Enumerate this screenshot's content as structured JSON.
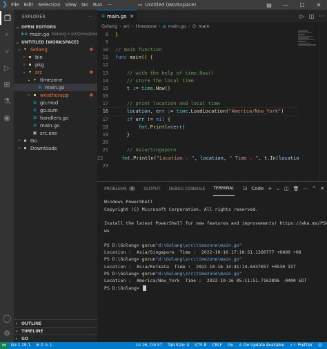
{
  "titlebar": {
    "menu": [
      "File",
      "Edit",
      "Selection",
      "View",
      "Go",
      "Run",
      "···"
    ],
    "title": "Untitled (Workspace)"
  },
  "sidebar": {
    "header": "EXPLORER",
    "open_editors": "OPEN EDITORS",
    "open_file": {
      "name": "main.go",
      "desc": "Golang • src\\timezone"
    },
    "workspace": "UNTITLED (WORKSPACE)",
    "tree": [
      {
        "label": "Golang",
        "kind": "folder",
        "open": true,
        "indent": 0,
        "color": "#e37933",
        "dot": true
      },
      {
        "label": "bin",
        "kind": "folder",
        "open": false,
        "indent": 1
      },
      {
        "label": "pkg",
        "kind": "folder",
        "open": false,
        "indent": 1
      },
      {
        "label": "src",
        "kind": "folder",
        "open": true,
        "indent": 1,
        "color": "#e37933",
        "dot": true
      },
      {
        "label": "timezone",
        "kind": "folder",
        "open": true,
        "indent": 2
      },
      {
        "label": "main.go",
        "kind": "go",
        "indent": 3,
        "selected": true
      },
      {
        "label": "weatherapp",
        "kind": "folder",
        "open": false,
        "indent": 2,
        "color": "#e37933",
        "dot": true
      },
      {
        "label": "go.mod",
        "kind": "go",
        "indent": 2
      },
      {
        "label": "go.sum",
        "kind": "go",
        "indent": 2
      },
      {
        "label": "handlers.go",
        "kind": "go",
        "indent": 2
      },
      {
        "label": "main.go",
        "kind": "go",
        "indent": 2
      },
      {
        "label": "src.exe",
        "kind": "exe",
        "indent": 2
      },
      {
        "label": "Go",
        "kind": "folder",
        "open": false,
        "indent": 0
      },
      {
        "label": "Downloads",
        "kind": "folder",
        "open": false,
        "indent": 0
      }
    ],
    "outline": "OUTLINE",
    "timeline": "TIMELINE",
    "go_section": "GO"
  },
  "editor": {
    "tab": "main.go",
    "breadcrumb": [
      "Golang",
      "src",
      "timezone",
      "main.go",
      "main"
    ],
    "lines": [
      {
        "n": 8,
        "html": "<span class=\"pu\">}</span>"
      },
      {
        "n": 9,
        "html": ""
      },
      {
        "n": 10,
        "html": "<span class=\"cm\">// main function</span>"
      },
      {
        "n": 11,
        "html": "<span class=\"kw\">func</span> <span class=\"fn\">main</span><span class=\"pu\">()</span> <span class=\"pu\">{</span>"
      },
      {
        "n": 12,
        "html": ""
      },
      {
        "n": 13,
        "html": "    <span class=\"cm\">// with the help of time.Now()</span>"
      },
      {
        "n": 14,
        "html": "    <span class=\"cm\">// store the local time</span>"
      },
      {
        "n": 15,
        "html": "    <span class=\"vr\">t</span> := <span class=\"ty\">time</span>.<span class=\"fn\">Now</span>()"
      },
      {
        "n": 16,
        "html": ""
      },
      {
        "n": 17,
        "html": "    <span class=\"cm\">// print location and local time</span>"
      },
      {
        "n": 16,
        "html": "    <span class=\"vr\">location</span>, <span class=\"vr\">err</span> := <span class=\"ty\">time</span>.<span class=\"fn\">LoadLocation</span>(<span class=\"st\">\"America/New_York\"</span>)",
        "current": true
      },
      {
        "n": 17,
        "html": "    <span class=\"kw\">if</span> <span class=\"vr\">err</span> != <span class=\"kw\">nil</span> {"
      },
      {
        "n": 18,
        "html": "        <span class=\"ty\">fmt</span>.<span class=\"fn\">Println</span>(<span class=\"vr\">err</span>)"
      },
      {
        "n": 19,
        "html": "    }"
      },
      {
        "n": 20,
        "html": ""
      },
      {
        "n": 21,
        "html": "    <span class=\"cm\">// Asia/Singapore</span>"
      },
      {
        "n": 22,
        "html": "    <span class=\"ty\">fmt</span>.<span class=\"fn\">Println</span>(<span class=\"st\">\"Location : \"</span>, <span class=\"vr\">location</span>, <span class=\"st\">\" Time : \"</span>, <span class=\"vr\">t</span>.<span class=\"fn\">In</span>(<span class=\"vr\">locatio</span>"
      },
      {
        "n": 23,
        "html": ""
      }
    ]
  },
  "panel": {
    "tabs": [
      {
        "label": "PROBLEMS",
        "badge": "1"
      },
      {
        "label": "OUTPUT"
      },
      {
        "label": "DEBUG CONSOLE"
      },
      {
        "label": "TERMINAL",
        "active": true
      }
    ],
    "shell_label": "Code",
    "terminal": [
      {
        "html": "Windows PowerShell"
      },
      {
        "html": "Copyright (C) Microsoft Corporation. All rights reserved."
      },
      {
        "html": ""
      },
      {
        "html": "Install the latest PowerShell for new features and improvements! https://aka.ms/PSWindo"
      },
      {
        "html": "ws"
      },
      {
        "html": ""
      },
      {
        "html": "PS D:\\Golang&gt; <span class=\"cmd\">go</span> <span class=\"arg\">run</span> <span class=\"path\">\"d:\\Golang\\src\\timezone\\main.go\"</span>"
      },
      {
        "html": "Location :  Asia/Singapore  Time :  2022-10-16 17:10:51.1360777 +0800 +08"
      },
      {
        "html": "PS D:\\Golang&gt; <span class=\"cmd\">go</span> <span class=\"arg\">run</span> <span class=\"path\">\"d:\\Golang\\src\\timezone\\main.go\"</span>"
      },
      {
        "html": "Location :  Asia/Kolkata  Time :  2022-10-16 14:41:14.6437657 +0530 IST"
      },
      {
        "html": "PS D:\\Golang&gt; <span class=\"cmd\">go</span> <span class=\"arg\">run</span> <span class=\"path\">\"d:\\Golang\\src\\timezone\\main.go\"</span>"
      },
      {
        "html": "Location :  America/New_York  Time :  2022-10-16 05:11:51.7163896 -0400 EDT"
      },
      {
        "html": "PS D:\\Golang&gt; <span class=\"cursor\"></span>"
      }
    ]
  },
  "statusbar": {
    "go_version": "Go 1.19.1",
    "errors": "0",
    "warnings": "1",
    "position": "Ln 16, Col 57",
    "tab_size": "Tab Size: 4",
    "encoding": "UTF-8",
    "eol": "CRLF",
    "language": "Go",
    "update": "Go Update Available",
    "prettier": "Prettier"
  },
  "colors": {
    "accent": "#007acc",
    "modified": "#c74e39",
    "folder": "#dcb67a",
    "go": "#00add8"
  }
}
